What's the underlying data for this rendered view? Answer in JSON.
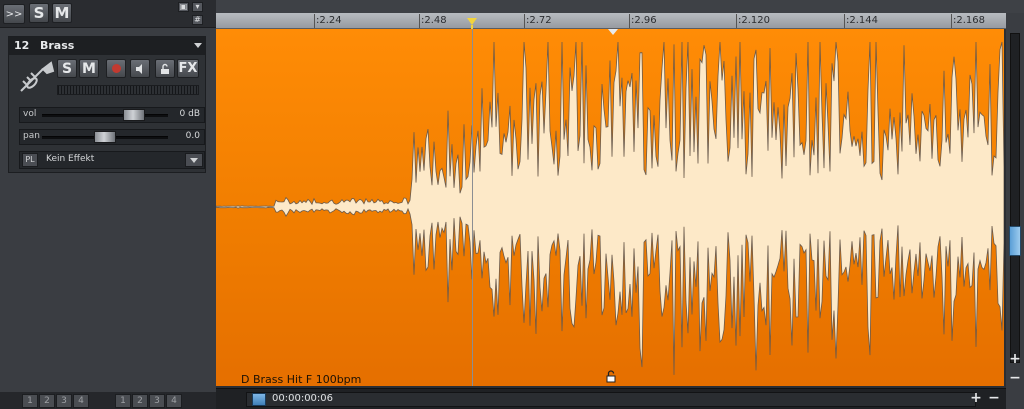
{
  "toolbar": {
    "expand": ">>",
    "solo_all": "S",
    "mute_all": "M"
  },
  "track": {
    "number": "12",
    "name": "Brass",
    "solo": "S",
    "mute": "M",
    "fx": "FX",
    "vol_label": "vol",
    "vol_value": "0 dB",
    "vol_level": 0.78,
    "pan_label": "pan",
    "pan_value": "0.0",
    "pan_level": 0.5,
    "fx_pl": "PL",
    "fx_effect": "Kein Effekt"
  },
  "ruler": {
    "ticks": [
      ":2.24",
      ":2.48",
      ":2.72",
      ":2.96",
      ":2.120",
      ":2.144",
      ":2.168"
    ]
  },
  "clip": {
    "name": "D Brass Hit F 100bpm",
    "color": "#f07d00"
  },
  "timeline": {
    "timecode": "00:00:00:06"
  },
  "bottom_groups": {
    "left": [
      "1",
      "2",
      "3",
      "4"
    ],
    "right": [
      "1",
      "2",
      "3",
      "4"
    ]
  },
  "scroll": {
    "plus": "+",
    "minus": "−"
  }
}
